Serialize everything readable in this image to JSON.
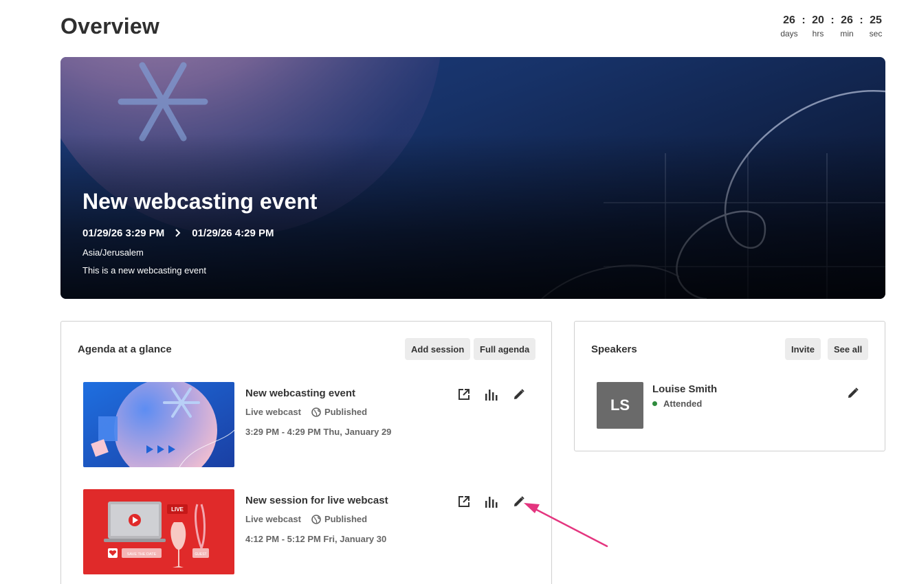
{
  "page": {
    "title": "Overview"
  },
  "countdown": {
    "days": "26",
    "hrs": "20",
    "min": "26",
    "sec": "25",
    "days_label": "days",
    "hrs_label": "hrs",
    "min_label": "min",
    "sec_label": "sec",
    "separator": ":"
  },
  "hero": {
    "title": "New webcasting event",
    "start": "01/29/26 3:29 PM",
    "end": "01/29/26 4:29 PM",
    "timezone": "Asia/Jerusalem",
    "description": "This is a new webcasting event"
  },
  "agenda": {
    "title": "Agenda at a glance",
    "add_session_label": "Add session",
    "full_agenda_label": "Full agenda",
    "sessions": [
      {
        "title": "New webcasting event",
        "type": "Live webcast",
        "status": "Published",
        "time": "3:29 PM - 4:29 PM Thu, January 29"
      },
      {
        "title": "New session for live webcast",
        "type": "Live webcast",
        "status": "Published",
        "time": "4:12 PM - 5:12 PM Fri, January 30",
        "thumb_text": {
          "live": "LIVE",
          "save_the_date": "SAVE THE DATE",
          "guest": "GUEST"
        }
      }
    ]
  },
  "speakers": {
    "title": "Speakers",
    "invite_label": "Invite",
    "see_all_label": "See all",
    "items": [
      {
        "initials": "LS",
        "name": "Louise Smith",
        "status": "Attended"
      }
    ]
  },
  "colors": {
    "accent_arrow": "#e4357f",
    "status_attended": "#2e8b3d",
    "button_bg": "#ececec"
  }
}
